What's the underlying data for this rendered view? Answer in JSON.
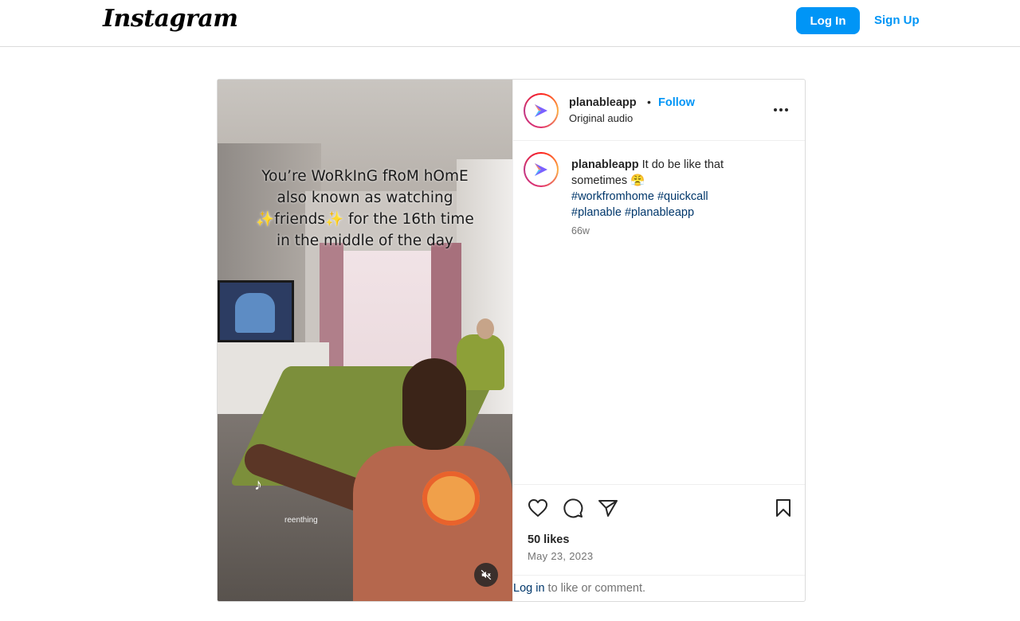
{
  "brand": {
    "logo_text": "Instagram"
  },
  "topbar": {
    "login_label": "Log In",
    "signup_label": "Sign Up"
  },
  "media": {
    "overlay_lines": [
      "You’re WoRkInG fRoM hOmE",
      "also known as watching",
      "✨friends✨ for the 16th time",
      "in the middle of the day"
    ],
    "watermark": "reenthing",
    "mute_icon": "muted-speaker-icon"
  },
  "post_header": {
    "username": "planableapp",
    "separator": "•",
    "follow_label": "Follow",
    "audio": "Original audio",
    "more_icon": "more-options-icon"
  },
  "caption": {
    "username": "planableapp",
    "text": " It do be like that sometimes 😤",
    "hashtags": [
      "#workfromhome",
      "#quickcall",
      "#planable",
      "#planableapp"
    ],
    "time": "66w"
  },
  "actions": {
    "icons": [
      "heart-icon",
      "comment-icon",
      "share-icon",
      "bookmark-icon"
    ],
    "likes": "50 likes",
    "date": "May 23, 2023"
  },
  "comment_prompt": {
    "login_link": "Log in",
    "text": " to like or comment."
  },
  "colors": {
    "accent": "#0095f6",
    "link_dark": "#00376b",
    "muted": "#737373",
    "border": "#dbdbdb"
  }
}
